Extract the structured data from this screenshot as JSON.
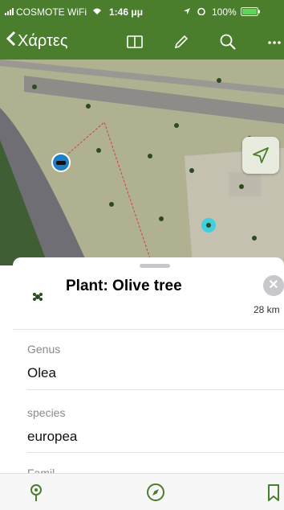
{
  "status": {
    "carrier": "COSMOTE WiFi",
    "time": "1:46 μμ",
    "battery": "100%"
  },
  "nav": {
    "back_label": "Χάρτες",
    "icons": [
      "book-icon",
      "pencil-icon",
      "search-icon",
      "more-icon"
    ]
  },
  "sheet": {
    "title": "Plant: Olive tree",
    "distance": "28 km",
    "fields": [
      {
        "label": "Genus",
        "value": "Olea"
      },
      {
        "label": "species",
        "value": "europea"
      }
    ],
    "partial_label": "Famil"
  },
  "tab_bar": {
    "icons": [
      "map-pin-icon",
      "compass-icon",
      "bookmark-icon"
    ]
  },
  "colors": {
    "accent": "#4a7d2c",
    "bar_bg": "#4a7d2c"
  }
}
